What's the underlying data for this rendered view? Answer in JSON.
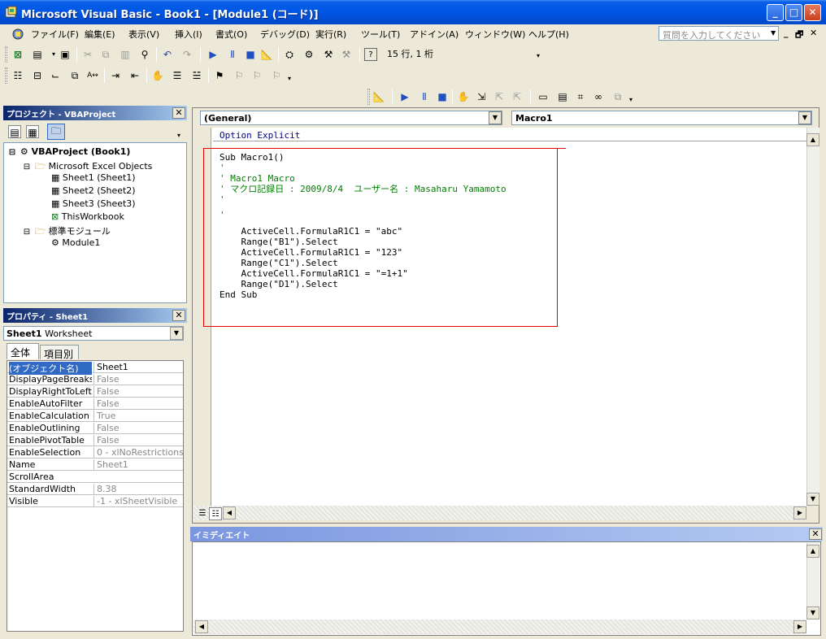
{
  "window": {
    "title": "Microsoft Visual Basic - Book1 - [Module1 (コード)]"
  },
  "menu": {
    "items": [
      "ファイル(F)",
      "編集(E)",
      "表示(V)",
      "挿入(I)",
      "書式(O)",
      "デバッグ(D)",
      "実行(R)",
      "ツール(T)",
      "アドイン(A)",
      "ウィンドウ(W)",
      "ヘルプ(H)"
    ],
    "help_placeholder": "質問を入力してください"
  },
  "toolbar": {
    "position_text": "15 行, 1 桁"
  },
  "project": {
    "title": "プロジェクト - VBAProject",
    "root": "VBAProject (Book1)",
    "folder_excel": "Microsoft Excel Objects",
    "sheets": [
      "Sheet1 (Sheet1)",
      "Sheet2 (Sheet2)",
      "Sheet3 (Sheet3)",
      "ThisWorkbook"
    ],
    "folder_modules": "標準モジュール",
    "module": "Module1"
  },
  "properties": {
    "title": "プロパティ - Sheet1",
    "object_name": "Sheet1",
    "object_type": "Worksheet",
    "tabs": [
      "全体",
      "項目別"
    ],
    "rows": [
      {
        "name": "(オブジェクト名)",
        "value": "Sheet1"
      },
      {
        "name": "DisplayPageBreaks",
        "value": "False"
      },
      {
        "name": "DisplayRightToLeft",
        "value": "False"
      },
      {
        "name": "EnableAutoFilter",
        "value": "False"
      },
      {
        "name": "EnableCalculation",
        "value": "True"
      },
      {
        "name": "EnableOutlining",
        "value": "False"
      },
      {
        "name": "EnablePivotTable",
        "value": "False"
      },
      {
        "name": "EnableSelection",
        "value": "0 - xlNoRestrictions"
      },
      {
        "name": "Name",
        "value": "Sheet1"
      },
      {
        "name": "ScrollArea",
        "value": ""
      },
      {
        "name": "StandardWidth",
        "value": "8.38"
      },
      {
        "name": "Visible",
        "value": "-1 - xlSheetVisible"
      }
    ]
  },
  "code": {
    "object_combo": "(General)",
    "proc_combo": "Macro1",
    "lines": [
      "Option Explicit",
      "Sub Macro1()",
      "'",
      "' Macro1 Macro",
      "' マクロ記録日 : 2009/8/4  ユーザー名 : Masaharu Yamamoto",
      "'",
      "",
      "'",
      "    ActiveCell.FormulaR1C1 = \"abc\"",
      "    Range(\"B1\").Select",
      "    ActiveCell.FormulaR1C1 = \"123\"",
      "    Range(\"C1\").Select",
      "    ActiveCell.FormulaR1C1 = \"=1+1\"",
      "    Range(\"D1\").Select",
      "End Sub"
    ]
  },
  "immediate": {
    "title": "イミディエイト"
  },
  "colors": {
    "title_bar": "#0058E6",
    "selection": "#316AC5",
    "comment": "#008000",
    "keyword": "#00008B",
    "highlight_box": "#E00000"
  }
}
